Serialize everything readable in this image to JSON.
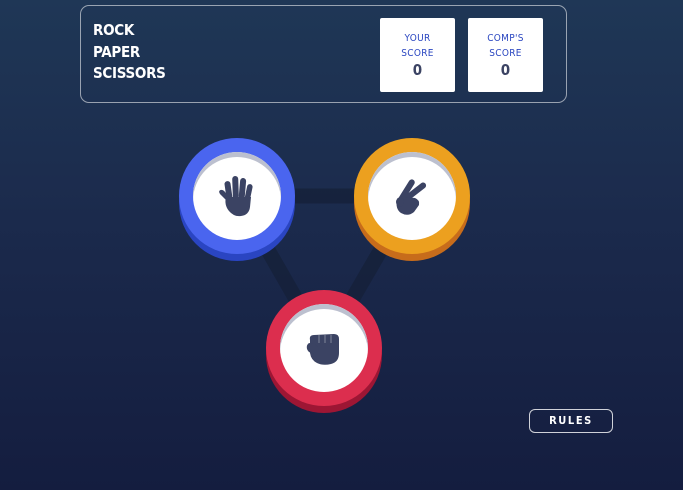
{
  "header": {
    "title_lines": [
      "ROCK",
      "PAPER",
      "SCISSORS"
    ],
    "player_score": {
      "label_lines": [
        "YOUR",
        "SCORE"
      ],
      "value": "0"
    },
    "comp_score": {
      "label_lines": [
        "COMP'S",
        "SCORE"
      ],
      "value": "0"
    }
  },
  "board": {
    "choices": [
      {
        "name": "paper",
        "icon": "hand-paper-icon",
        "color": "#4a65ef"
      },
      {
        "name": "scissors",
        "icon": "hand-scissors-icon",
        "color": "#eca01f"
      },
      {
        "name": "rock",
        "icon": "hand-rock-icon",
        "color": "#dc2e4e"
      }
    ]
  },
  "rules_button": {
    "label": "RULES"
  },
  "colors": {
    "background_top": "#1f3756",
    "background_bottom": "#141d3f",
    "score_text": "#3b4363",
    "score_label": "#2a46c0"
  }
}
